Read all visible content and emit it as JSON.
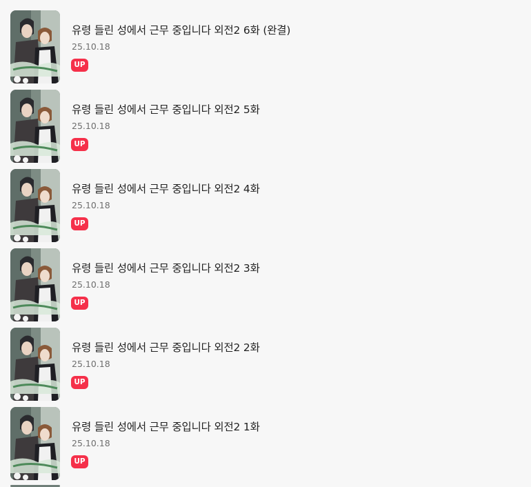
{
  "episodes": [
    {
      "title": "유령 들린 성에서 근무 중입니다 외전2 6화 (완결)",
      "date": "25.10.18",
      "badge": "UP"
    },
    {
      "title": "유령 들린 성에서 근무 중입니다 외전2 5화",
      "date": "25.10.18",
      "badge": "UP"
    },
    {
      "title": "유령 들린 성에서 근무 중입니다 외전2 4화",
      "date": "25.10.18",
      "badge": "UP"
    },
    {
      "title": "유령 들린 성에서 근무 중입니다 외전2 3화",
      "date": "25.10.18",
      "badge": "UP"
    },
    {
      "title": "유령 들린 성에서 근무 중입니다 외전2 2화",
      "date": "25.10.18",
      "badge": "UP"
    },
    {
      "title": "유령 들린 성에서 근무 중입니다 외전2 1화",
      "date": "25.10.18",
      "badge": "UP"
    }
  ],
  "colors": {
    "background": "#f7f7f7",
    "badge": "#f5304a",
    "title": "#222222",
    "date": "#6e6e6e"
  }
}
